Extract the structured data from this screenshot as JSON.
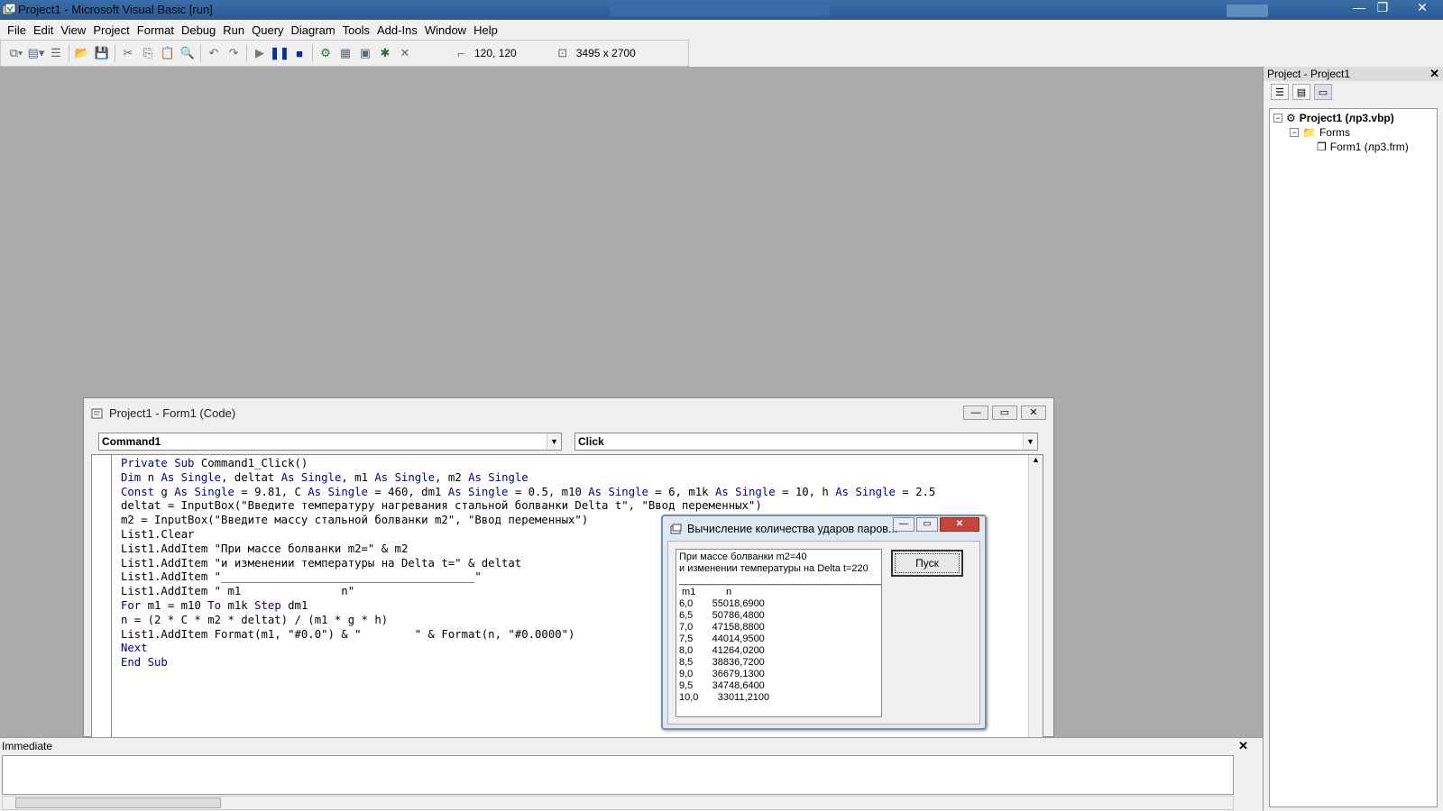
{
  "window": {
    "title": "Project1 - Microsoft Visual Basic [run]",
    "controls": {
      "minimize": "—",
      "restore": "❐",
      "close": "✕"
    }
  },
  "menu": [
    "File",
    "Edit",
    "View",
    "Project",
    "Format",
    "Debug",
    "Run",
    "Query",
    "Diagram",
    "Tools",
    "Add-Ins",
    "Window",
    "Help"
  ],
  "toolbar": {
    "position": "120, 120",
    "size": "3495 x 2700"
  },
  "project_explorer": {
    "title": "Project - Project1",
    "close": "✕",
    "tree": {
      "project": "Project1 (лр3.vbp)",
      "forms_folder": "Forms",
      "form": "Form1 (лр3.frm)"
    }
  },
  "code_window": {
    "title": "Project1 - Form1 (Code)",
    "object_combo": "Command1",
    "proc_combo": "Click",
    "lines": [
      [
        [
          "kw",
          "Private Sub "
        ],
        [
          "t",
          "Command1_Click()"
        ]
      ],
      [
        [
          "kw",
          "Dim "
        ],
        [
          "t",
          "n "
        ],
        [
          "kw",
          "As Single"
        ],
        [
          "t",
          ", deltat "
        ],
        [
          "kw",
          "As Single"
        ],
        [
          "t",
          ", m1 "
        ],
        [
          "kw",
          "As Single"
        ],
        [
          "t",
          ", m2 "
        ],
        [
          "kw",
          "As Single"
        ]
      ],
      [
        [
          "kw",
          "Const "
        ],
        [
          "t",
          "g "
        ],
        [
          "kw",
          "As Single"
        ],
        [
          "t",
          " = 9.81, C "
        ],
        [
          "kw",
          "As Single"
        ],
        [
          "t",
          " = 460, dm1 "
        ],
        [
          "kw",
          "As Single"
        ],
        [
          "t",
          " = 0.5, m10 "
        ],
        [
          "kw",
          "As Single"
        ],
        [
          "t",
          " = 6, m1k "
        ],
        [
          "kw",
          "As Single"
        ],
        [
          "t",
          " = 10, h "
        ],
        [
          "kw",
          "As Single"
        ],
        [
          "t",
          " = 2.5"
        ]
      ],
      [
        [
          "t",
          "deltat = InputBox(\"Введите температуру нагревания стальной болванки Delta t\", \"Ввод переменных\")"
        ]
      ],
      [
        [
          "t",
          "m2 = InputBox(\"Введите массу стальной болванки m2\", \"Ввод переменных\")"
        ]
      ],
      [
        [
          "t",
          "List1.Clear"
        ]
      ],
      [
        [
          "t",
          "List1.AddItem \"При массе болванки m2=\" & m2"
        ]
      ],
      [
        [
          "t",
          "List1.AddItem \"и изменении температуры на Delta t=\" & deltat"
        ]
      ],
      [
        [
          "t",
          "List1.AddItem \"______________________________________\""
        ]
      ],
      [
        [
          "t",
          "List1.AddItem \" m1               n\""
        ]
      ],
      [
        [
          "kw",
          "For "
        ],
        [
          "t",
          "m1 = m10 "
        ],
        [
          "kw",
          "To "
        ],
        [
          "t",
          "m1k "
        ],
        [
          "kw",
          "Step "
        ],
        [
          "t",
          "dm1"
        ]
      ],
      [
        [
          "t",
          "n = (2 * C * m2 * deltat) / (m1 * g * h)"
        ]
      ],
      [
        [
          "t",
          "List1.AddItem Format(m1, \"#0.0\") & \"        \" & Format(n, \"#0.0000\")"
        ]
      ],
      [
        [
          "kw",
          "Next"
        ]
      ],
      [
        [
          "kw",
          "End Sub"
        ]
      ]
    ]
  },
  "form1": {
    "title": "Вычисление количества ударов паров...",
    "button": "Пуск",
    "list_header": [
      "При массе болванки m2=40",
      "и изменении температуры на Delta t=220",
      "________________________________________"
    ],
    "list_cols": [
      " m1           n"
    ],
    "list_rows": [
      "6,0       55018,6900",
      "6,5       50786,4800",
      "7,0       47158,8800",
      "7,5       44014,9500",
      "8,0       41264,0200",
      "8,5       38836,7200",
      "9,0       36679,1300",
      "9,5       34748,6400",
      "10,0       33011,2100"
    ]
  },
  "immediate": {
    "title": "Immediate",
    "close": "✕"
  }
}
